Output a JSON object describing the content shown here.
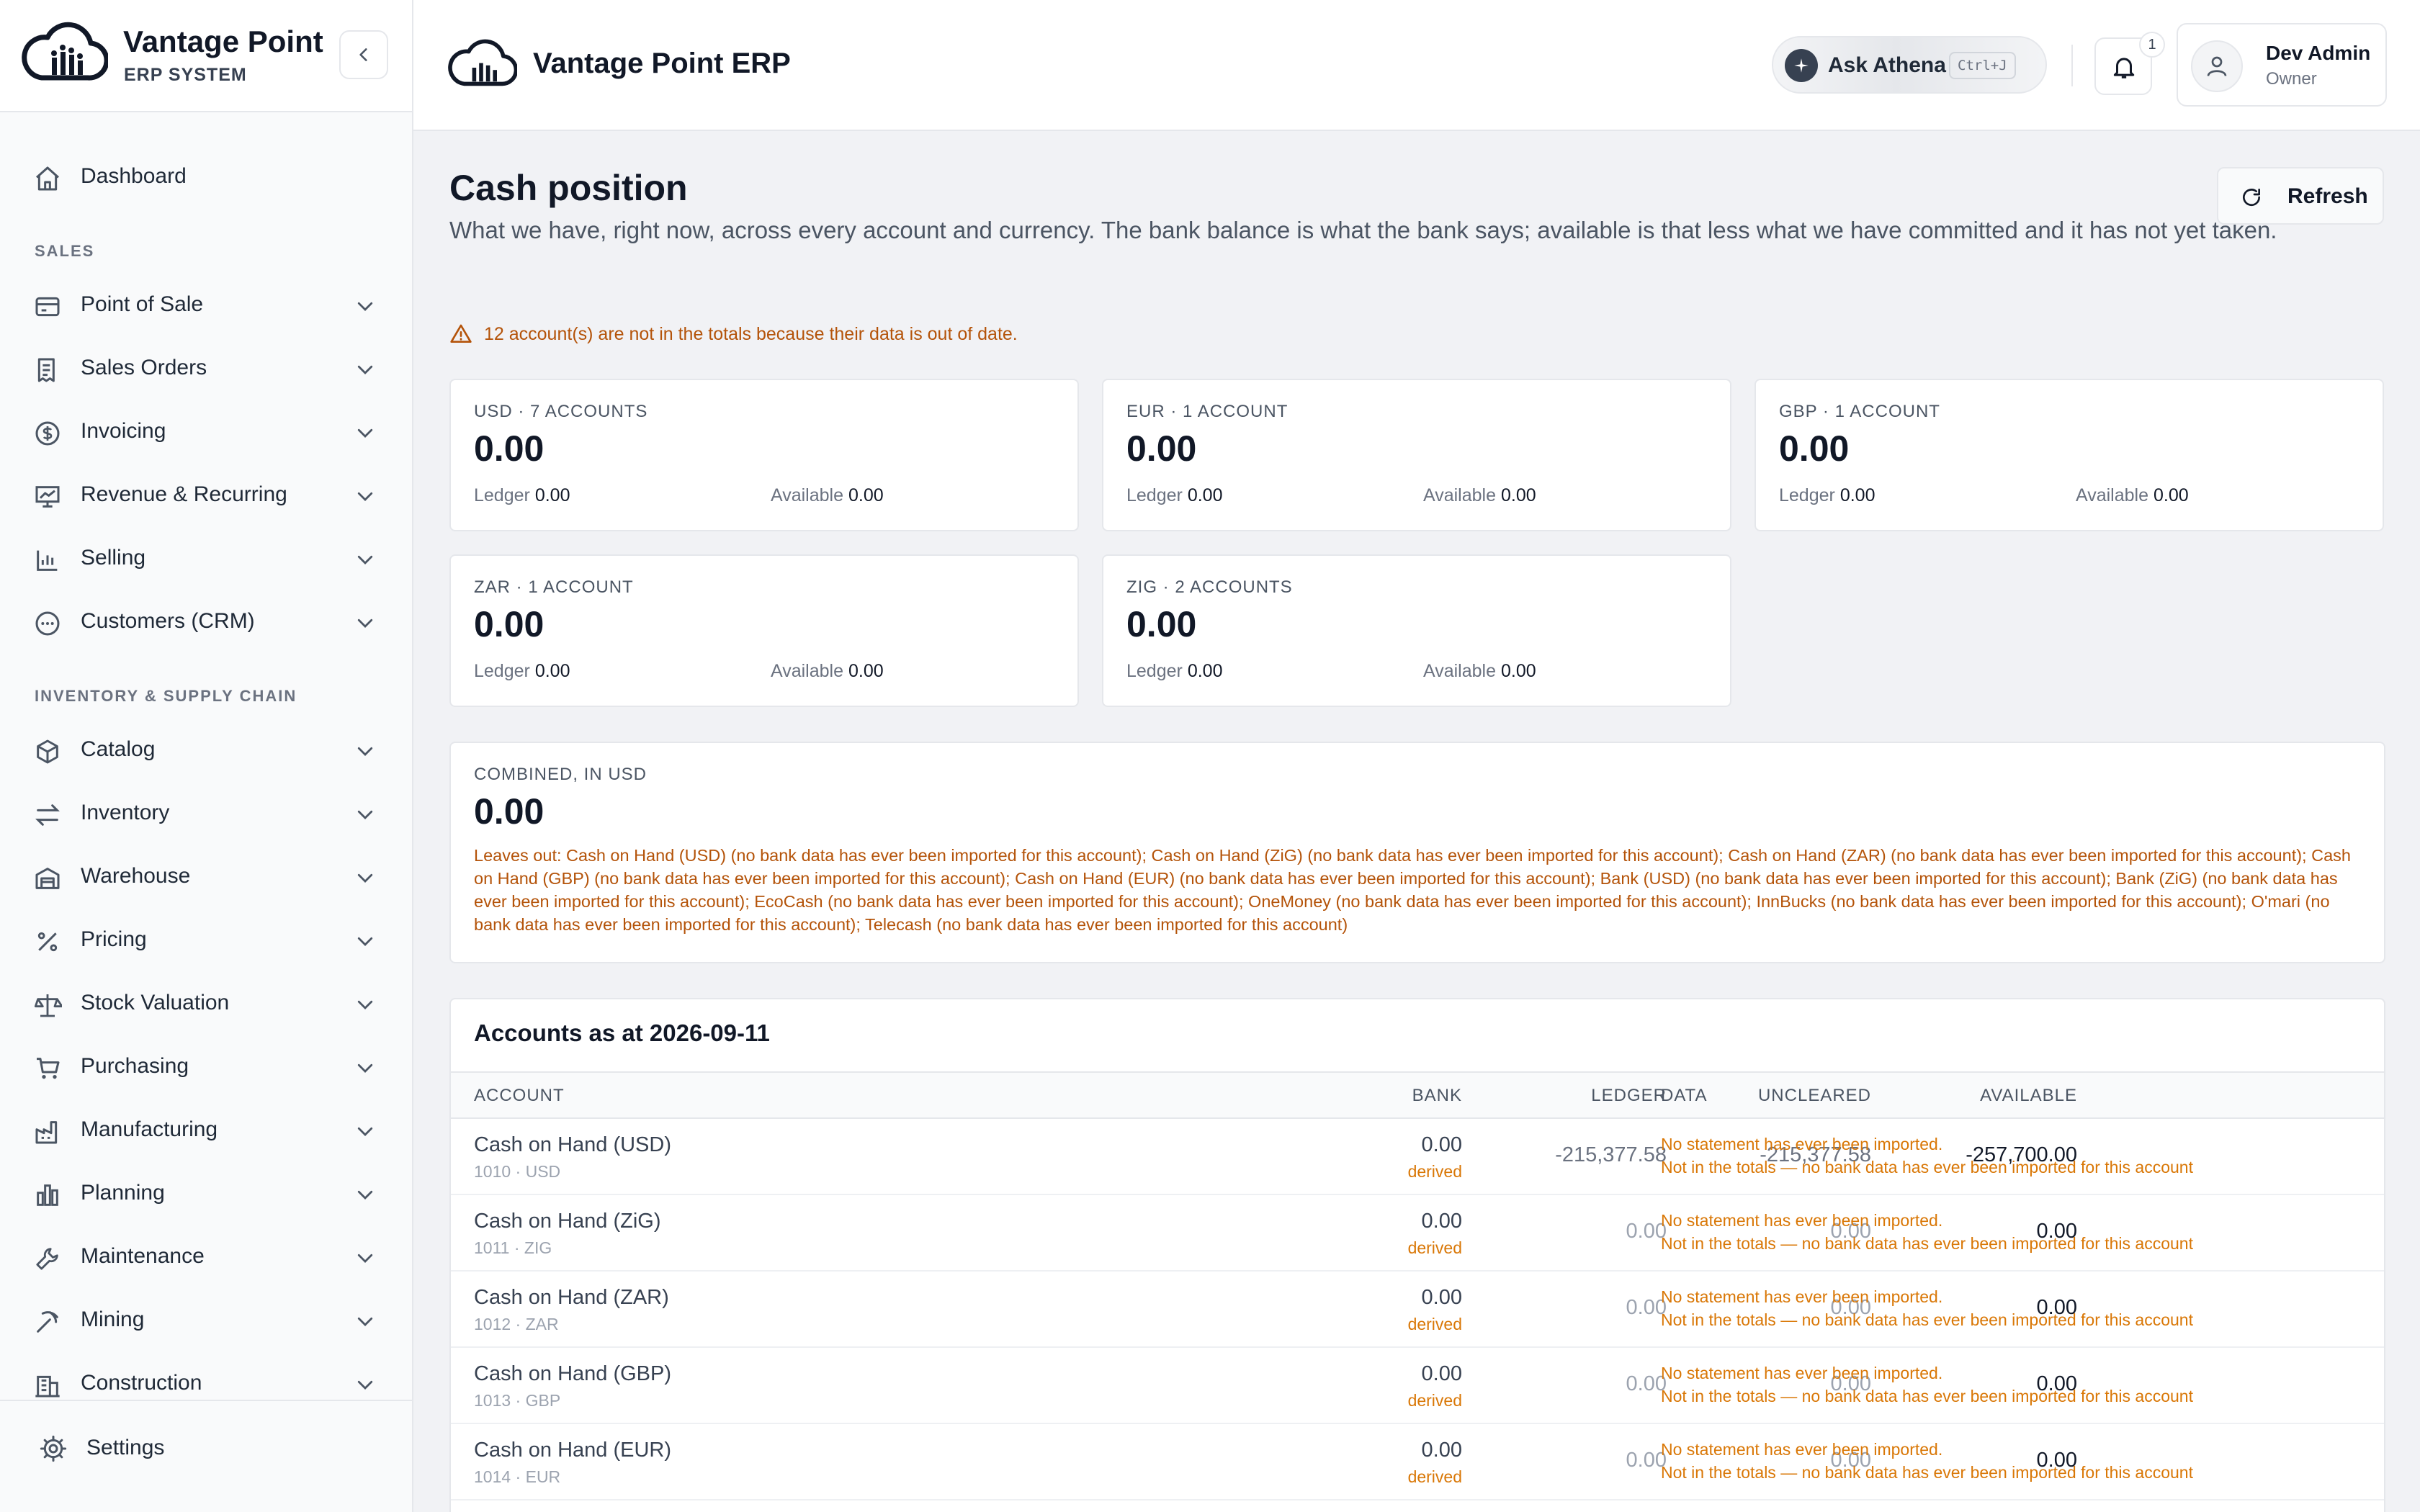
{
  "brand": {
    "name": "Vantage Point",
    "subtitle": "ERP SYSTEM",
    "app_title": "Vantage Point ERP"
  },
  "colors": {
    "accent": "#111827",
    "warning": "#b45309",
    "derived": "#d97706",
    "border": "#e5e7eb",
    "page_bg": "#f1f2f5"
  },
  "sidebar": {
    "top_item": {
      "label": "Dashboard",
      "icon": "home-icon"
    },
    "sections": [
      {
        "title": "SALES",
        "items": [
          {
            "label": "Point of Sale",
            "icon": "credit-card-icon"
          },
          {
            "label": "Sales Orders",
            "icon": "receipt-icon"
          },
          {
            "label": "Invoicing",
            "icon": "dollar-circle-icon"
          },
          {
            "label": "Revenue & Recurring",
            "icon": "chart-presentation-icon"
          },
          {
            "label": "Selling",
            "icon": "bar-chart-icon"
          },
          {
            "label": "Customers (CRM)",
            "icon": "chat-bubble-icon"
          }
        ]
      },
      {
        "title": "INVENTORY & SUPPLY CHAIN",
        "items": [
          {
            "label": "Catalog",
            "icon": "box-icon"
          },
          {
            "label": "Inventory",
            "icon": "arrows-swap-icon"
          },
          {
            "label": "Warehouse",
            "icon": "warehouse-icon"
          },
          {
            "label": "Pricing",
            "icon": "percent-icon"
          },
          {
            "label": "Stock Valuation",
            "icon": "scale-icon"
          },
          {
            "label": "Purchasing",
            "icon": "cart-icon"
          },
          {
            "label": "Manufacturing",
            "icon": "factory-icon"
          },
          {
            "label": "Planning",
            "icon": "columns-chart-icon"
          },
          {
            "label": "Maintenance",
            "icon": "wrench-icon"
          },
          {
            "label": "Mining",
            "icon": "pickaxe-icon"
          },
          {
            "label": "Construction",
            "icon": "building-icon"
          }
        ]
      }
    ],
    "footer": {
      "label": "Settings",
      "icon": "gear-icon"
    }
  },
  "header": {
    "ask_label": "Ask Athena",
    "ask_shortcut": "Ctrl+J",
    "notification_count": "1",
    "user_name": "Dev Admin",
    "user_role": "Owner"
  },
  "page": {
    "title": "Cash position",
    "description": "What we have, right now, across every account and currency. The bank balance is what the bank says; available is that less what we have committed and it has not yet taken.",
    "refresh_label": "Refresh",
    "warning": "12 account(s) are not in the totals because their data is out of date."
  },
  "currencies": [
    {
      "heading": "USD · 7 ACCOUNTS",
      "amount": "0.00",
      "ledger_label": "Ledger",
      "ledger": "0.00",
      "available_label": "Available",
      "available": "0.00"
    },
    {
      "heading": "EUR · 1 ACCOUNT",
      "amount": "0.00",
      "ledger_label": "Ledger",
      "ledger": "0.00",
      "available_label": "Available",
      "available": "0.00"
    },
    {
      "heading": "GBP · 1 ACCOUNT",
      "amount": "0.00",
      "ledger_label": "Ledger",
      "ledger": "0.00",
      "available_label": "Available",
      "available": "0.00"
    },
    {
      "heading": "ZAR · 1 ACCOUNT",
      "amount": "0.00",
      "ledger_label": "Ledger",
      "ledger": "0.00",
      "available_label": "Available",
      "available": "0.00"
    },
    {
      "heading": "ZIG · 2 ACCOUNTS",
      "amount": "0.00",
      "ledger_label": "Ledger",
      "ledger": "0.00",
      "available_label": "Available",
      "available": "0.00"
    }
  ],
  "combined": {
    "heading": "COMBINED, IN USD",
    "amount": "0.00",
    "note": "Leaves out: Cash on Hand (USD) (no bank data has ever been imported for this account); Cash on Hand (ZiG) (no bank data has ever been imported for this account); Cash on Hand (ZAR) (no bank data has ever been imported for this account); Cash on Hand (GBP) (no bank data has ever been imported for this account); Cash on Hand (EUR) (no bank data has ever been imported for this account); Bank (USD) (no bank data has ever been imported for this account); Bank (ZiG) (no bank data has ever been imported for this account); EcoCash (no bank data has ever been imported for this account); OneMoney (no bank data has ever been imported for this account); InnBucks (no bank data has ever been imported for this account); O'mari (no bank data has ever been imported for this account); Telecash (no bank data has ever been imported for this account)"
  },
  "accounts": {
    "title": "Accounts as at 2026-09-11",
    "columns": [
      "ACCOUNT",
      "BANK",
      "LEDGER",
      "UNCLEARED",
      "AVAILABLE",
      "DATA"
    ],
    "rows": [
      {
        "name": "Cash on Hand (USD)",
        "code": "1010 · USD",
        "bank": "0.00",
        "bank_note": "derived",
        "ledger": "-215,377.58",
        "uncleared": "-215,377.58",
        "available": "-257,700.00",
        "data_1": "No statement has ever been imported.",
        "data_2": "Not in the totals — no bank data has ever been imported for this account"
      },
      {
        "name": "Cash on Hand (ZiG)",
        "code": "1011 · ZIG",
        "bank": "0.00",
        "bank_note": "derived",
        "ledger": "0.00",
        "uncleared": "0.00",
        "available": "0.00",
        "data_1": "No statement has ever been imported.",
        "data_2": "Not in the totals — no bank data has ever been imported for this account"
      },
      {
        "name": "Cash on Hand (ZAR)",
        "code": "1012 · ZAR",
        "bank": "0.00",
        "bank_note": "derived",
        "ledger": "0.00",
        "uncleared": "0.00",
        "available": "0.00",
        "data_1": "No statement has ever been imported.",
        "data_2": "Not in the totals — no bank data has ever been imported for this account"
      },
      {
        "name": "Cash on Hand (GBP)",
        "code": "1013 · GBP",
        "bank": "0.00",
        "bank_note": "derived",
        "ledger": "0.00",
        "uncleared": "0.00",
        "available": "0.00",
        "data_1": "No statement has ever been imported.",
        "data_2": "Not in the totals — no bank data has ever been imported for this account"
      },
      {
        "name": "Cash on Hand (EUR)",
        "code": "1014 · EUR",
        "bank": "0.00",
        "bank_note": "derived",
        "ledger": "0.00",
        "uncleared": "0.00",
        "available": "0.00",
        "data_1": "No statement has ever been imported.",
        "data_2": "Not in the totals — no bank data has ever been imported for this account"
      }
    ]
  }
}
